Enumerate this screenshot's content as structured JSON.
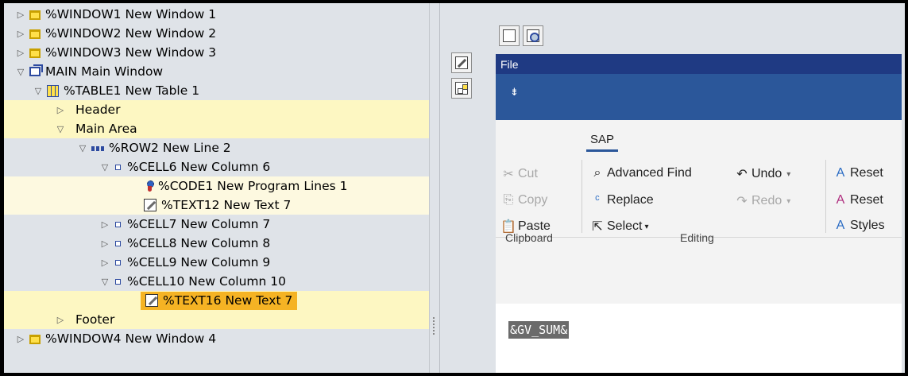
{
  "tree": {
    "items": [
      {
        "toggle": "▷",
        "icon": "window-icon",
        "label": "%WINDOW1 New Window 1"
      },
      {
        "toggle": "▷",
        "icon": "window-icon",
        "label": "%WINDOW2 New Window 2"
      },
      {
        "toggle": "▷",
        "icon": "window-icon",
        "label": "%WINDOW3 New Window 3"
      },
      {
        "toggle": "▽",
        "icon": "main-window-icon",
        "label": "MAIN Main Window"
      },
      {
        "toggle": "▽",
        "icon": "table-icon",
        "label": "%TABLE1 New Table 1"
      },
      {
        "toggle": "▷",
        "icon": "",
        "label": "Header"
      },
      {
        "toggle": "▽",
        "icon": "",
        "label": "Main Area"
      },
      {
        "toggle": "▽",
        "icon": "row-icon",
        "label": "%ROW2 New Line 2"
      },
      {
        "toggle": "▽",
        "icon": "cell-icon",
        "label": "%CELL6 New Column 6"
      },
      {
        "toggle": "",
        "icon": "program-lines-icon",
        "label": "%CODE1 New Program Lines 1"
      },
      {
        "toggle": "",
        "icon": "text-node-icon",
        "label": "%TEXT12 New Text 7"
      },
      {
        "toggle": "▷",
        "icon": "cell-icon",
        "label": "%CELL7 New Column 7"
      },
      {
        "toggle": "▷",
        "icon": "cell-icon",
        "label": "%CELL8 New Column 8"
      },
      {
        "toggle": "▷",
        "icon": "cell-icon",
        "label": "%CELL9 New Column 9"
      },
      {
        "toggle": "▽",
        "icon": "cell-icon",
        "label": "%CELL10 New Column 10"
      },
      {
        "toggle": "",
        "icon": "text-node-icon",
        "label": "%TEXT16 New Text 7"
      },
      {
        "toggle": "▷",
        "icon": "",
        "label": "Footer"
      },
      {
        "toggle": "▷",
        "icon": "window-icon",
        "label": "%WINDOW4 New Window 4"
      }
    ],
    "selected": "%TEXT16 New Text 7"
  },
  "editor": {
    "menu_file": "File",
    "qat_glyph": "⇟",
    "tab": "SAP",
    "clipboard": {
      "cut": "Cut",
      "copy": "Copy",
      "paste": "Paste",
      "group_label": "Clipboard"
    },
    "editing": {
      "advanced_find": "Advanced Find",
      "undo": "Undo",
      "redo": "Redo",
      "replace": "Replace",
      "select": "Select",
      "group_label": "Editing"
    },
    "styles": {
      "reset1": "Reset",
      "reset2": "Reset",
      "styles": "Styles"
    },
    "document_text": "&GV_SUM&"
  },
  "colors": {
    "panel_bg": "#dfe3e8",
    "row_cream": "#fdf9e0",
    "row_yellow": "#fdf7c2",
    "selection": "#f5b324",
    "word_menubar": "#1f3a83",
    "word_qat": "#2b579a"
  }
}
